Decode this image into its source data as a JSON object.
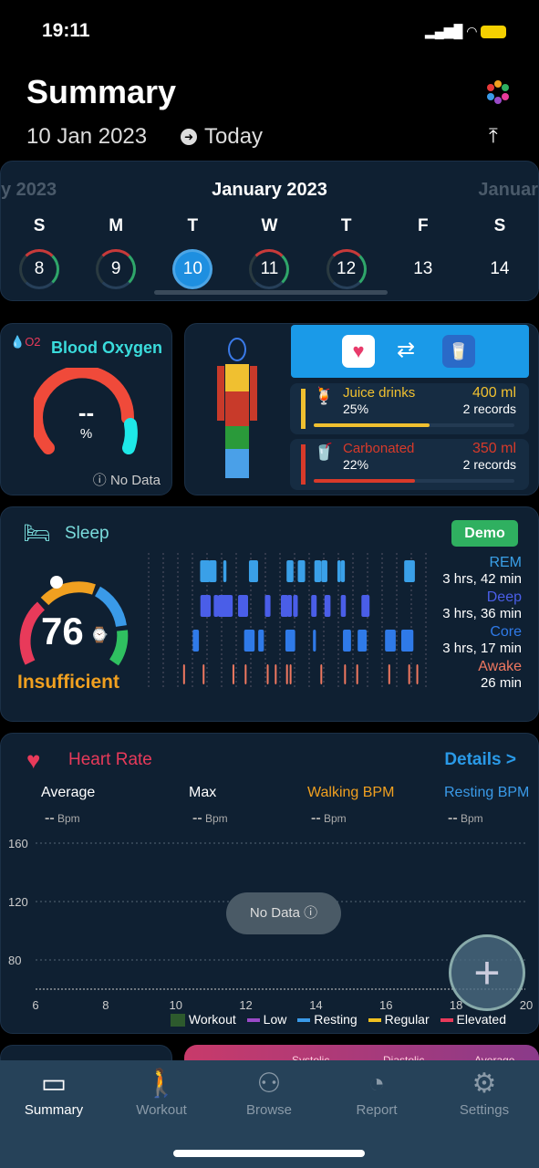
{
  "status": {
    "time": "19:11"
  },
  "header": {
    "title": "Summary",
    "date": "10 Jan 2023",
    "today": "Today"
  },
  "calendar": {
    "month": "January 2023",
    "prev": "y 2023",
    "next": "Januar",
    "days": [
      {
        "l": "S",
        "n": "8",
        "r": true
      },
      {
        "l": "M",
        "n": "9",
        "r": true
      },
      {
        "l": "T",
        "n": "10",
        "sel": true
      },
      {
        "l": "W",
        "n": "11",
        "r": true
      },
      {
        "l": "T",
        "n": "12",
        "r": true
      },
      {
        "l": "F",
        "n": "13"
      },
      {
        "l": "S",
        "n": "14"
      }
    ]
  },
  "oxygen": {
    "title": "Blood Oxygen",
    "value": "--",
    "unit": "%",
    "nodata": "No Data",
    "icon_text": "O2"
  },
  "water": {
    "drinks": [
      {
        "name": "Juice drinks",
        "pct": "25%",
        "fill": 25,
        "amount": "400 ml",
        "records": "2 records",
        "color": "#f0c030"
      },
      {
        "name": "Carbonated",
        "pct": "22%",
        "fill": 22,
        "amount": "350 ml",
        "records": "2 records",
        "color": "#d83a2a"
      }
    ]
  },
  "sleep": {
    "title": "Sleep",
    "badge": "Demo",
    "score": "76",
    "quality": "Insufficient",
    "stages": [
      {
        "name": "REM",
        "time": "3 hrs, 42 min",
        "color": "#3aa0e8"
      },
      {
        "name": "Deep",
        "time": "3 hrs, 36 min",
        "color": "#4a5ee8"
      },
      {
        "name": "Core",
        "time": "3 hrs, 17 min",
        "color": "#2f7ae8"
      },
      {
        "name": "Awake",
        "time": "26 min",
        "color": "#f07860"
      }
    ]
  },
  "heart": {
    "title": "Heart Rate",
    "details": "Details >",
    "stats": [
      {
        "label": "Average",
        "value": "--",
        "unit": "Bpm"
      },
      {
        "label": "Max",
        "value": "--",
        "unit": "Bpm"
      },
      {
        "label": "Walking BPM",
        "value": "--",
        "unit": "Bpm"
      },
      {
        "label": "Resting BPM",
        "value": "--",
        "unit": "Bpm"
      }
    ],
    "nodata": "No Data",
    "chart_data": {
      "type": "line",
      "x_ticks": [
        "6",
        "8",
        "10",
        "12",
        "14",
        "16",
        "18",
        "20"
      ],
      "y_ticks": [
        "160",
        "120",
        "80"
      ],
      "xlim": [
        6,
        20
      ],
      "ylim": [
        60,
        160
      ],
      "series": [],
      "legend": [
        {
          "name": "Workout",
          "color": "#2d5a2d"
        },
        {
          "name": "Low",
          "color": "#9a4ac8"
        },
        {
          "name": "Resting",
          "color": "#3a9ae8"
        },
        {
          "name": "Regular",
          "color": "#f0c020"
        },
        {
          "name": "Elevated",
          "color": "#e83a5a"
        }
      ]
    }
  },
  "bp": {
    "cols": [
      "Systolic",
      "Diastolic",
      "Average"
    ]
  },
  "tabs": [
    {
      "label": "Summary",
      "icon": "summary-icon",
      "g": "▭"
    },
    {
      "label": "Workout",
      "icon": "walking-icon",
      "g": "🚶"
    },
    {
      "label": "Browse",
      "icon": "grid-icon",
      "g": "⚇"
    },
    {
      "label": "Report",
      "icon": "pie-chart-icon",
      "g": "◔"
    },
    {
      "label": "Settings",
      "icon": "gear-icon",
      "g": "⚙"
    }
  ]
}
